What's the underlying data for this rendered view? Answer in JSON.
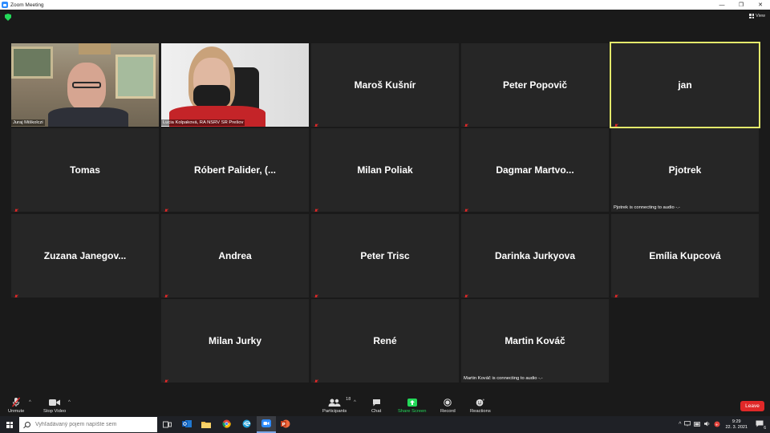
{
  "window": {
    "title": "Zoom Meeting",
    "controls": {
      "minimize": "—",
      "restore": "❐",
      "close": "✕"
    }
  },
  "top": {
    "view_label": "View"
  },
  "participants": [
    {
      "name": "Juraj Miškolczi",
      "video": true
    },
    {
      "name": "Lucia Kolpaková, RA NSRV SR Prešov",
      "video": true
    },
    {
      "name": "Maroš Kušnír"
    },
    {
      "name": "Peter Popovič"
    },
    {
      "name": "jan",
      "active_speaker": true
    },
    {
      "name": "Tomas"
    },
    {
      "name": "Róbert Palider, (..."
    },
    {
      "name": "Milan Poliak"
    },
    {
      "name": "Dagmar Martvo..."
    },
    {
      "name": "Pjotrek",
      "status": "Pjotrek is connecting to audio -.-"
    },
    {
      "name": "Zuzana Janegov..."
    },
    {
      "name": "Andrea"
    },
    {
      "name": "Peter Trisc"
    },
    {
      "name": "Darinka Jurkyova"
    },
    {
      "name": "Emília Kupcová"
    },
    {
      "name": "Milan Jurky"
    },
    {
      "name": "René"
    },
    {
      "name": "Martin Kováč",
      "status": "Martin Kováč is connecting to audio -.-"
    }
  ],
  "toolbar": {
    "unmute": "Unmute",
    "stop_video": "Stop Video",
    "participants": "Participants",
    "participants_count": "18",
    "chat": "Chat",
    "share_screen": "Share Screen",
    "record": "Record",
    "reactions": "Reactions",
    "leave": "Leave"
  },
  "taskbar": {
    "search_placeholder": "Vyhľadávaný pojem napíšte sem",
    "time": "9:29",
    "date": "22. 3. 2021",
    "notifications_count": "6"
  },
  "colors": {
    "accent_green": "#23d959",
    "leave_red": "#e02828",
    "active_border": "#e4e96b",
    "mute_red": "#e02828"
  }
}
